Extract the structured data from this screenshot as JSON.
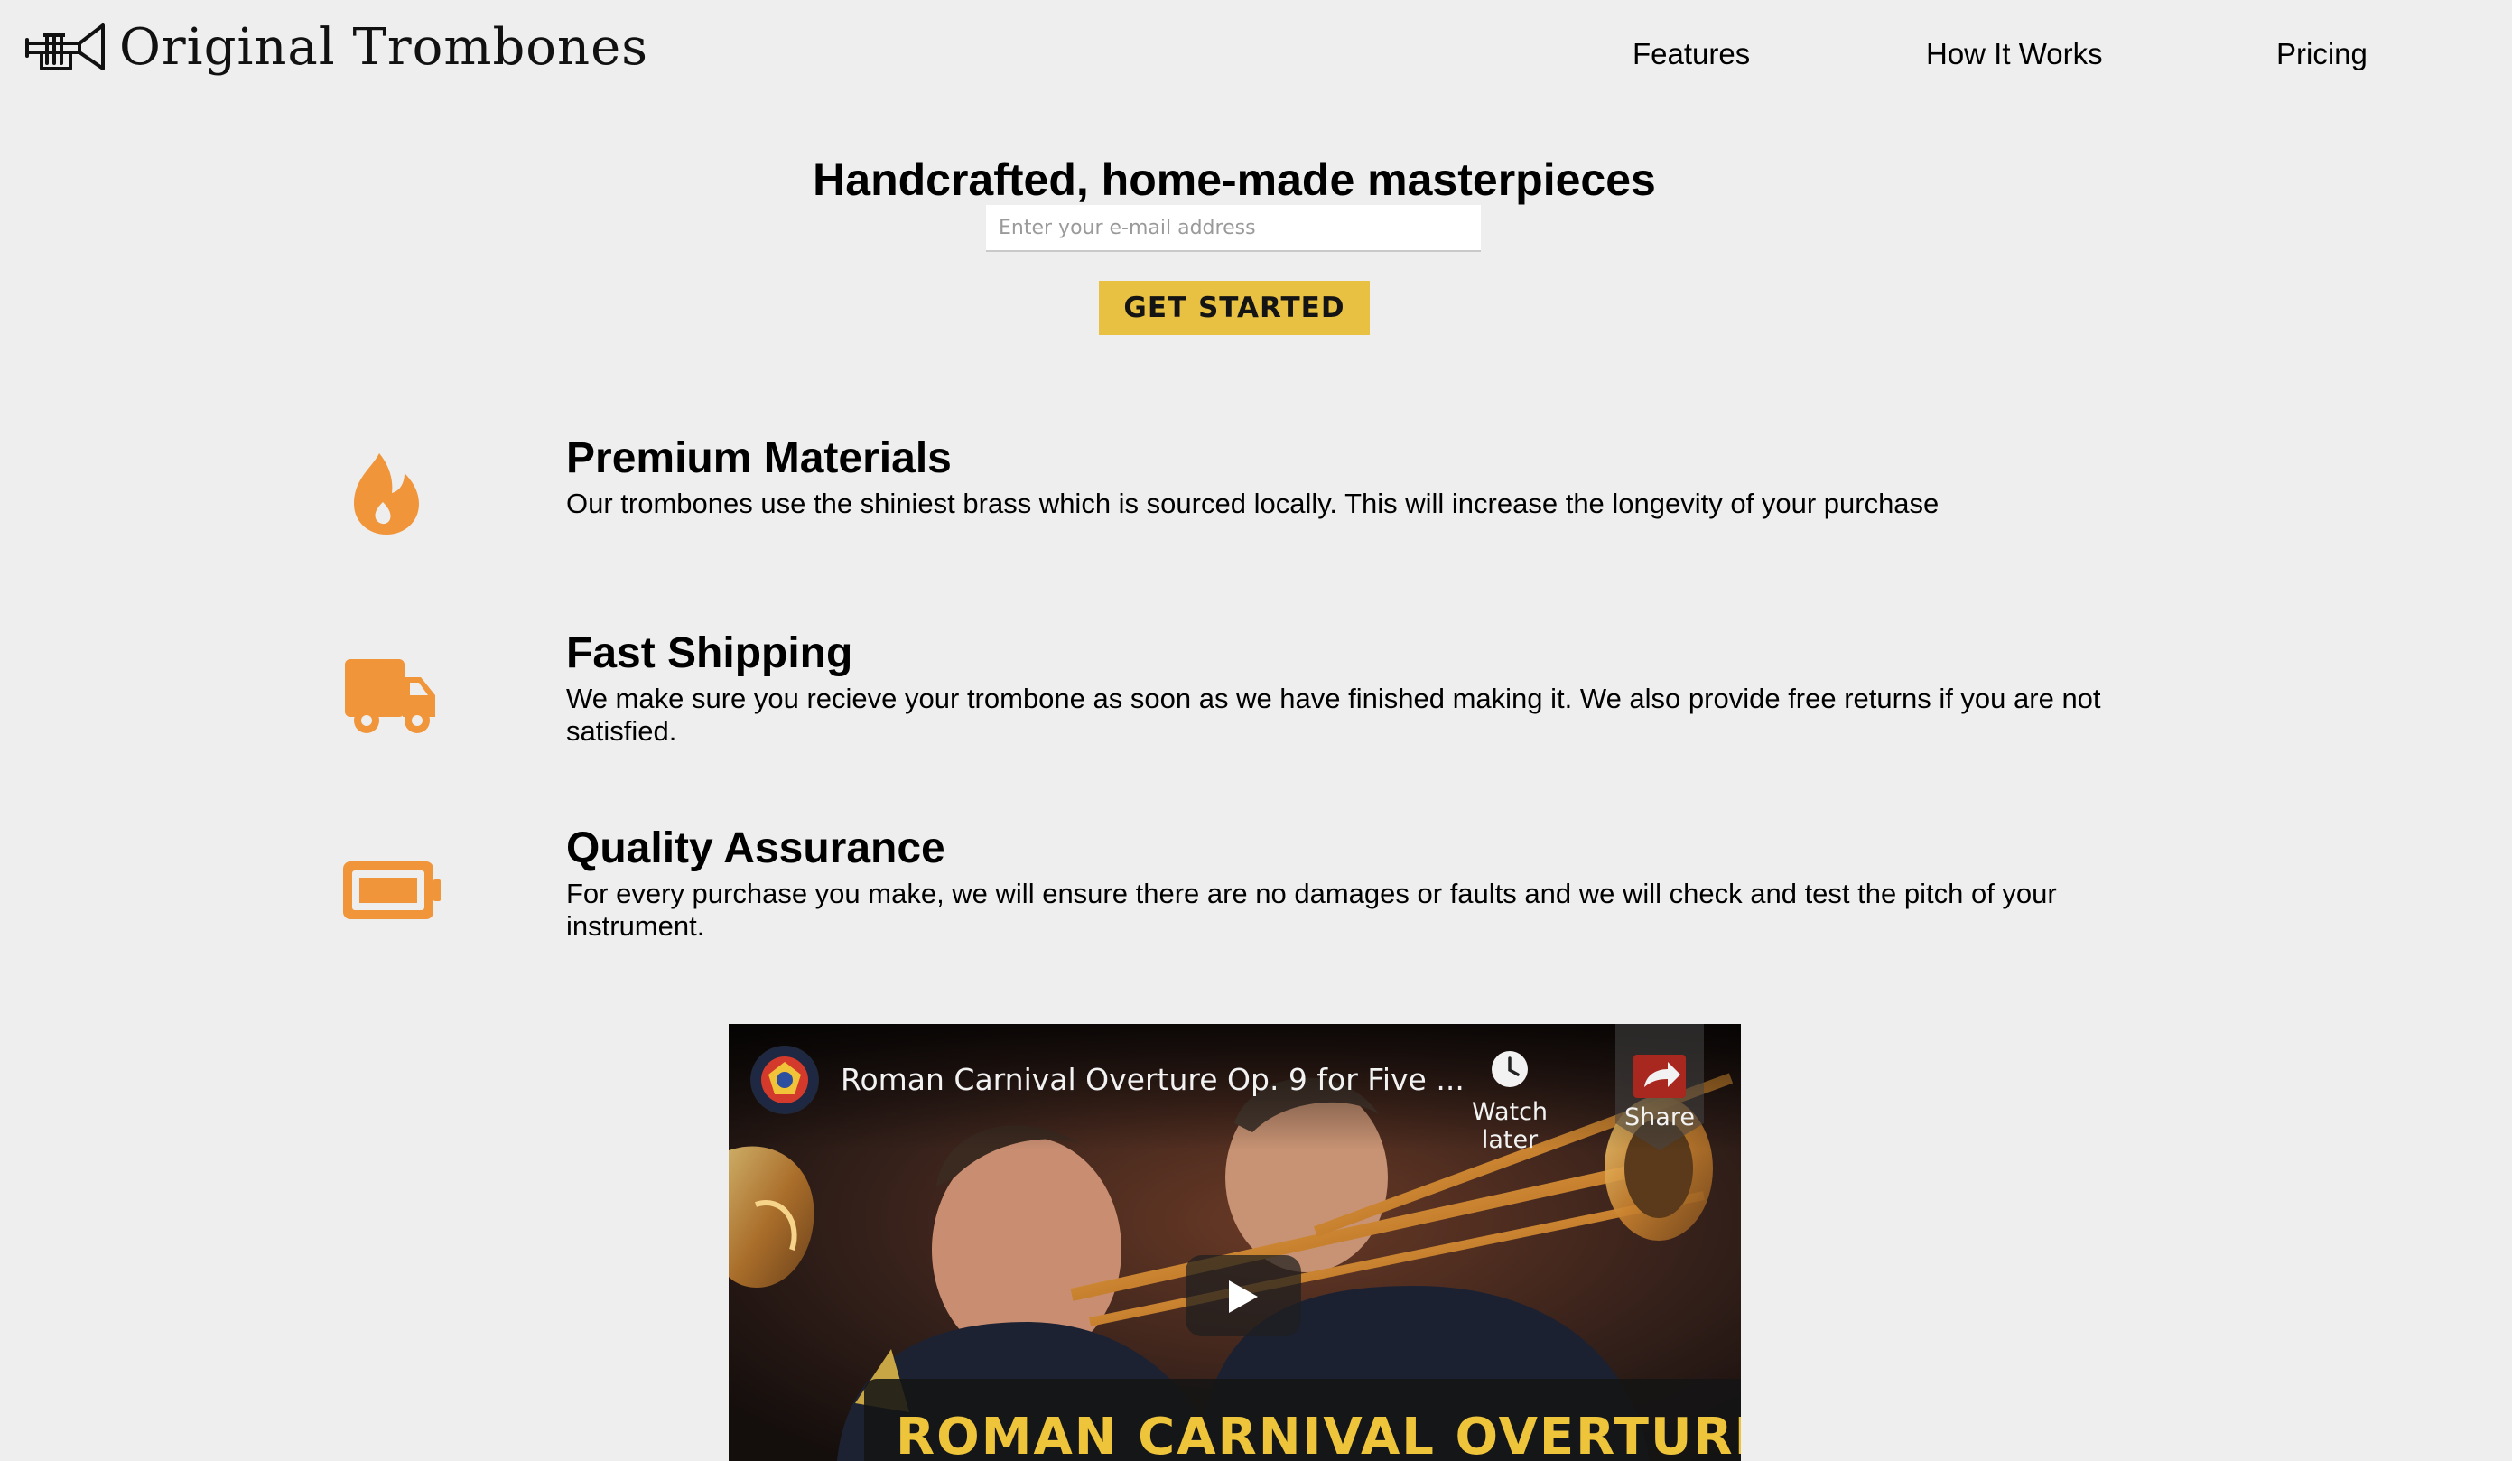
{
  "header": {
    "brand": "Original Trombones",
    "logo_icon": "trumpet-icon",
    "nav": [
      {
        "label": "Features"
      },
      {
        "label": "How It Works"
      },
      {
        "label": "Pricing"
      }
    ]
  },
  "hero": {
    "title": "Handcrafted, home-made masterpieces",
    "email_placeholder": "Enter your e-mail address",
    "email_value": "",
    "cta_label": "GET STARTED",
    "cta_color": "#e8c143"
  },
  "features": [
    {
      "icon": "fire-icon",
      "title": "Premium Materials",
      "description": "Our trombones use the shiniest brass which is sourced locally. This will increase the longevity of your purchase"
    },
    {
      "icon": "truck-icon",
      "title": "Fast Shipping",
      "description": "We make sure you recieve your trombone as soon as we have finished making it. We also provide free returns if you are not satisfied."
    },
    {
      "icon": "battery-icon",
      "title": "Quality Assurance",
      "description": "For every purchase you make, we will ensure there are no damages or faults and we will check and test the pitch of your instrument."
    }
  ],
  "accent_color": "#f0953a",
  "video": {
    "title": "Roman Carnival Overture Op. 9 for Five ...",
    "watch_later_label": "Watch later",
    "share_label": "Share",
    "banner_text": "ROMAN CARNIVAL OVERTURE",
    "channel_icon": "army-band-logo-icon",
    "play_icon": "play-icon"
  }
}
